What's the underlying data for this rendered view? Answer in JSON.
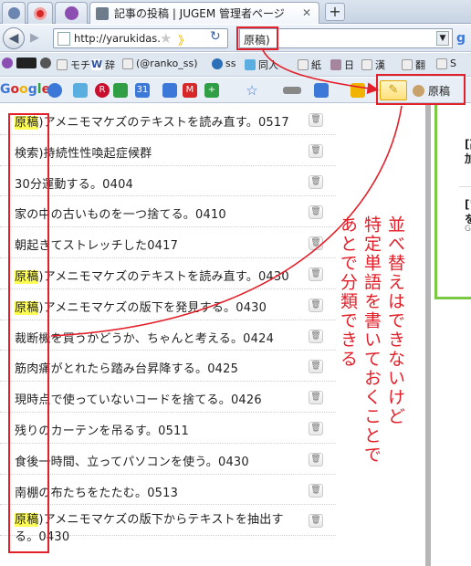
{
  "browser": {
    "active_tab_title": "記事の投稿 | JUGEM 管理者ページ",
    "new_tab_label": "+",
    "url": "http://yarukidas.",
    "search_query": "原稿)"
  },
  "bookmarks": [
    {
      "label": "モチ"
    },
    {
      "label": "辞"
    },
    {
      "label": "(@ranko_ss)"
    },
    {
      "label": "ss"
    },
    {
      "label": "同人"
    },
    {
      "label": "紙"
    },
    {
      "label": "日"
    },
    {
      "label": "漢"
    },
    {
      "label": "翻"
    },
    {
      "label": "S"
    }
  ],
  "google_toolbar": {
    "logo": "Google",
    "highlight_term": "原稿"
  },
  "entries": [
    {
      "prefix": "原稿",
      "rest": ")アメニモマケズのテキストを読み直す。0517"
    },
    {
      "prefix": "",
      "rest": "検索)持続性性喚起症候群"
    },
    {
      "prefix": "",
      "rest": "30分運動する。0404"
    },
    {
      "prefix": "",
      "rest": "家の中の古いものを一つ捨てる。0410"
    },
    {
      "prefix": "",
      "rest": "朝起きてストレッチした0417"
    },
    {
      "prefix": "原稿",
      "rest": ")アメニモマケズのテキストを読み直す。0430"
    },
    {
      "prefix": "原稿",
      "rest": ")アメニモマケズの版下を発見する。0430"
    },
    {
      "prefix": "",
      "rest": "裁断機を買うかどうか、ちゃんと考える。0424"
    },
    {
      "prefix": "",
      "rest": "筋肉痛がとれたら踏み台昇降する。0425"
    },
    {
      "prefix": "",
      "rest": "現時点で使っていないコードを捨てる。0426"
    },
    {
      "prefix": "",
      "rest": "残りのカーテンを吊るす。0511"
    },
    {
      "prefix": "",
      "rest": "食後一時間、立ってパソコンを使う。0430"
    },
    {
      "prefix": "",
      "rest": "南棚の布たちをたたむ。0513"
    },
    {
      "prefix": "原稿",
      "rest": ")アメニモマケズの版下からテキストを抽出する。0430"
    }
  ],
  "sidebar": {
    "line1": "[高",
    "line2": "加",
    "line3": "[い",
    "line4": "を",
    "line5": "Ge"
  },
  "annotation": {
    "col1": "並べ替えはできないけど",
    "col2": "特定単語を書いておくことで",
    "col3": "あとで分類できる"
  },
  "colors": {
    "annotation_red": "#e3202a",
    "highlight_yellow": "#ffff55",
    "sidebar_green": "#7ac843"
  }
}
